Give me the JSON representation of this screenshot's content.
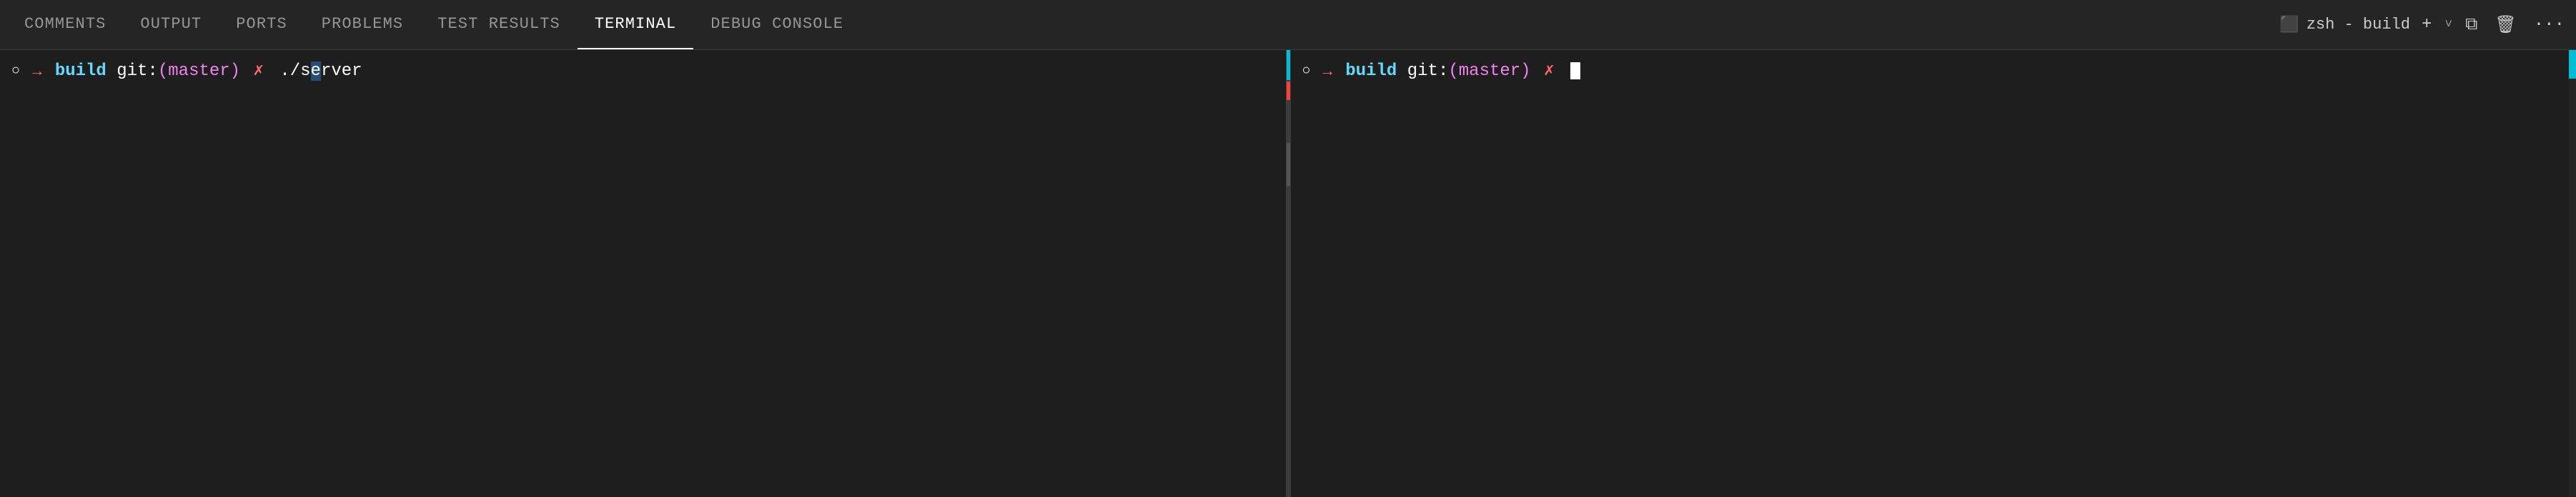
{
  "tabs": [
    {
      "id": "comments",
      "label": "COMMENTS",
      "active": false
    },
    {
      "id": "output",
      "label": "OUTPUT",
      "active": false
    },
    {
      "id": "ports",
      "label": "PORTS",
      "active": false
    },
    {
      "id": "problems",
      "label": "PROBLEMS",
      "active": false
    },
    {
      "id": "test-results",
      "label": "TEST RESULTS",
      "active": false
    },
    {
      "id": "terminal",
      "label": "TERMINAL",
      "active": true
    },
    {
      "id": "debug-console",
      "label": "DEBUG CONSOLE",
      "active": false
    }
  ],
  "header_right": {
    "terminal_label": "zsh - build",
    "add_label": "+",
    "split_label": "⊞",
    "trash_label": "🗑",
    "more_label": "···"
  },
  "pane_left": {
    "prompt": {
      "circle": "○",
      "arrow": "→",
      "dir": "build",
      "git_prefix": "git:",
      "branch_open": "(",
      "branch": "master",
      "branch_close": ")",
      "x": "✗",
      "cmd": "./server"
    }
  },
  "pane_right": {
    "prompt": {
      "circle": "○",
      "arrow": "→",
      "dir": "build",
      "git_prefix": "git:",
      "branch_open": "(",
      "branch": "master",
      "branch_close": ")",
      "x": "✗"
    }
  }
}
